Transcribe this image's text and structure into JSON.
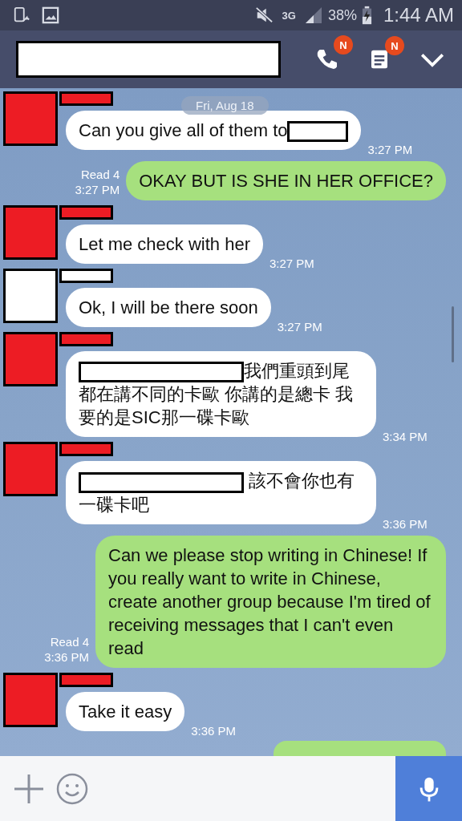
{
  "status_bar": {
    "network": "3G",
    "battery": "38%",
    "time": "1:44 AM"
  },
  "header": {
    "badges": [
      "N",
      "N"
    ]
  },
  "date_pill": "Fri, Aug 18",
  "messages": [
    {
      "kind": "incoming",
      "color": "#ed1c24",
      "parts": [
        {
          "kind": "text",
          "text": "Can you give all of them to"
        },
        {
          "kind": "redaction-short"
        }
      ],
      "time": "3:27 PM"
    },
    {
      "kind": "outgoing",
      "read": "Read 4",
      "parts": [
        {
          "kind": "text",
          "text": "OKAY BUT IS SHE IN HER OFFICE?"
        }
      ],
      "time": "3:27 PM"
    },
    {
      "kind": "incoming",
      "color": "#ed1c24",
      "parts": [
        {
          "kind": "text",
          "text": "Let me check with her"
        }
      ],
      "time": "3:27 PM"
    },
    {
      "kind": "incoming",
      "color": "#ffffff",
      "parts": [
        {
          "kind": "text",
          "text": "Ok, I will be there soon"
        }
      ],
      "time": "3:27 PM"
    },
    {
      "kind": "incoming",
      "color": "#ed1c24",
      "parts": [
        {
          "kind": "redaction-long"
        },
        {
          "kind": "text",
          "text": "我們重頭到尾都在講不同的卡歐 你講的是總卡 我要的是SIC那一碟卡歐"
        }
      ],
      "time": "3:34 PM"
    },
    {
      "kind": "incoming",
      "color": "#ed1c24",
      "parts": [
        {
          "kind": "redaction-long"
        },
        {
          "kind": "text",
          "text": " 該不會你也有一碟卡吧"
        }
      ],
      "time": "3:36 PM"
    },
    {
      "kind": "outgoing",
      "read": "Read 4",
      "parts": [
        {
          "kind": "text",
          "text": "Can we please stop writing in Chinese! If you really want to write in Chinese, create another group because I'm tired of receiving messages that I can't even read"
        }
      ],
      "time": "3:36 PM"
    },
    {
      "kind": "incoming",
      "color": "#ed1c24",
      "parts": [
        {
          "kind": "text",
          "text": "Take it easy"
        }
      ],
      "time": "3:36 PM"
    },
    {
      "kind": "outgoing-cut"
    }
  ]
}
